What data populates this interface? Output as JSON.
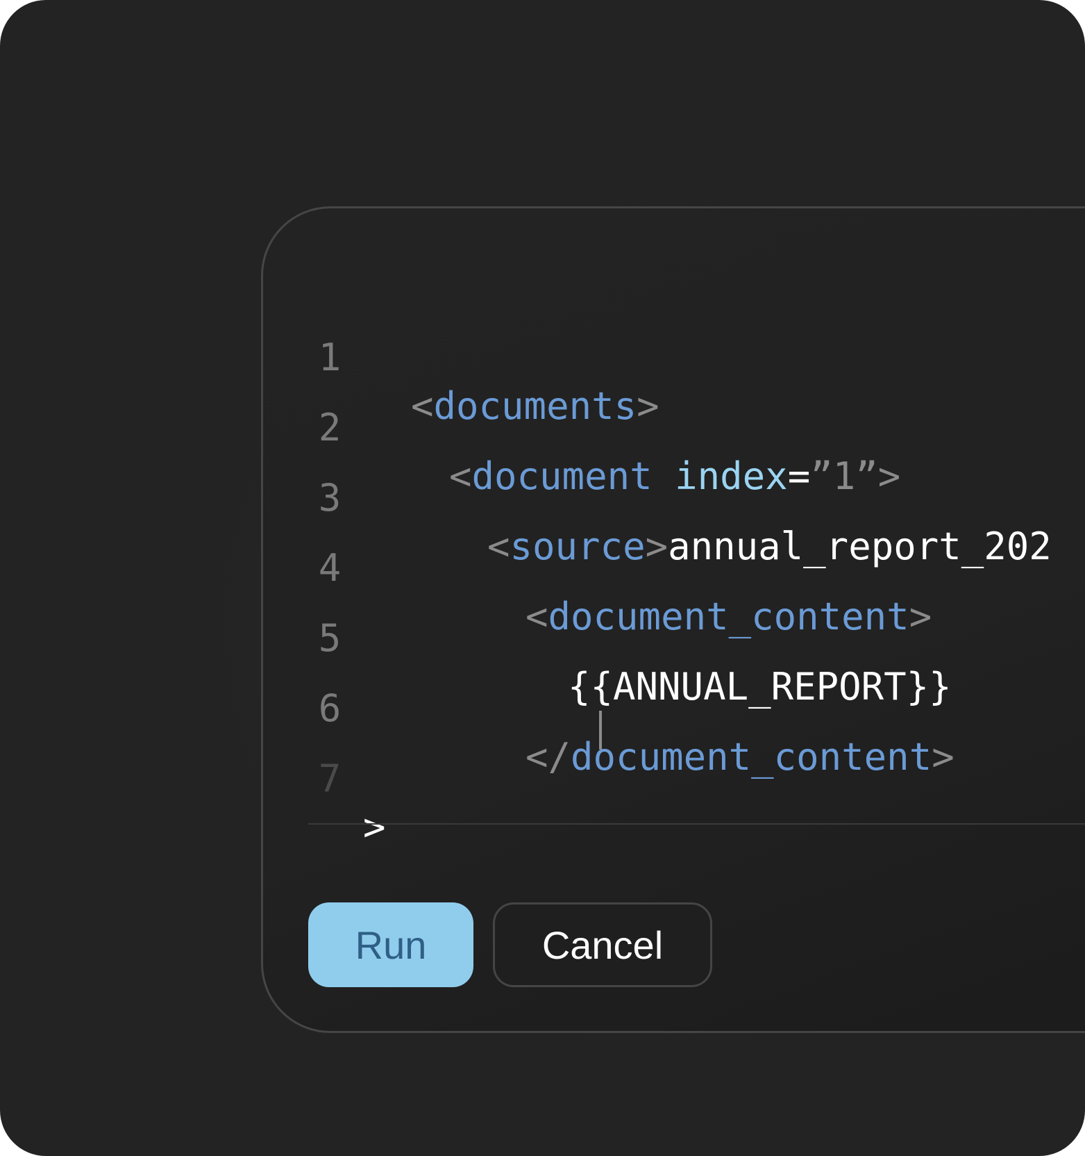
{
  "editor": {
    "lines": [
      {
        "num": "1",
        "parts": {
          "open": "<",
          "tag": "documents",
          "close": ">"
        }
      },
      {
        "num": "2",
        "parts": {
          "open": "<",
          "tag": "document",
          "attr": "index",
          "eq": "=",
          "val": "”1”",
          "close": ">"
        }
      },
      {
        "num": "3",
        "parts": {
          "open": "<",
          "tag": "source",
          "close": ">",
          "text": "annual_report_202"
        }
      },
      {
        "num": "4",
        "parts": {
          "open": "<",
          "tag": "document_content",
          "close": ">"
        }
      },
      {
        "num": "5",
        "parts": {
          "text": "{{ANNUAL_REPORT}}"
        }
      },
      {
        "num": "6",
        "parts": {
          "open": "</",
          "tag": "document_content",
          "close": ">"
        }
      },
      {
        "num": "7",
        "parts": {
          "prompt": ">"
        }
      }
    ]
  },
  "actions": {
    "run_label": "Run",
    "cancel_label": "Cancel"
  },
  "colors": {
    "background": "#232323",
    "tag": "#6b9bd6",
    "attribute": "#9bd4f2",
    "punctuation": "#8b8b8b",
    "text": "#ffffff",
    "run_button": "#90cded",
    "run_text": "#2f5f86"
  }
}
